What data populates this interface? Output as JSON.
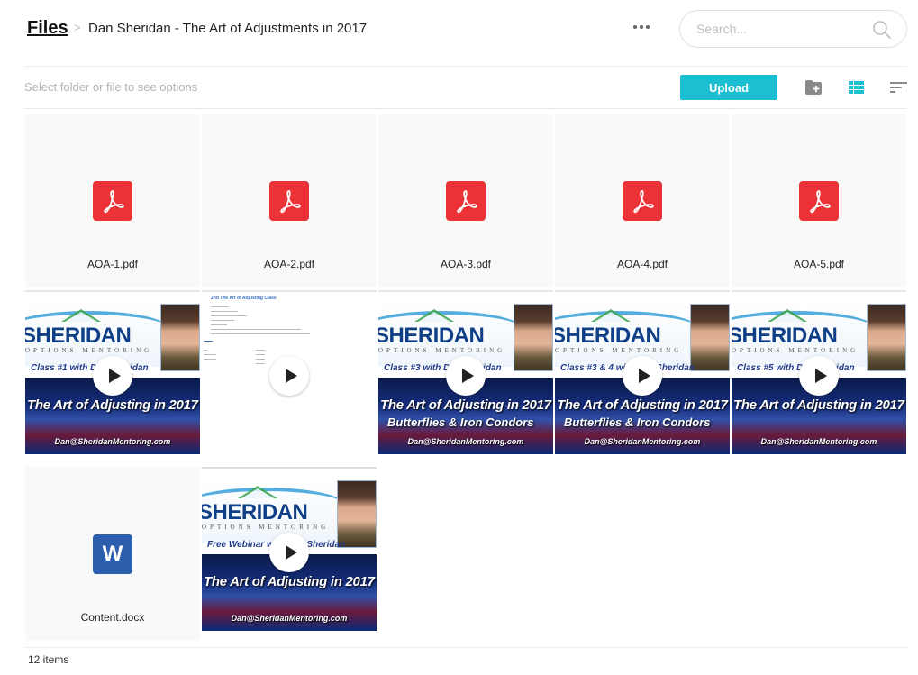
{
  "header": {
    "breadcrumb_root": "Files",
    "breadcrumb_sep": ">",
    "breadcrumb_current": "Dan Sheridan - The Art of Adjustments in 2017",
    "search_placeholder": "Search...",
    "search_value": ""
  },
  "toolbar": {
    "hint": "Select folder or file to see options",
    "upload_label": "Upload",
    "icons": [
      "new-folder-icon",
      "grid-view-icon",
      "sort-icon"
    ],
    "accent_color": "#1bbfd1"
  },
  "files": [
    {
      "name": "AOA-1.pdf",
      "type": "pdf"
    },
    {
      "name": "AOA-2.pdf",
      "type": "pdf"
    },
    {
      "name": "AOA-3.pdf",
      "type": "pdf"
    },
    {
      "name": "AOA-4.pdf",
      "type": "pdf"
    },
    {
      "name": "AOA-5.pdf",
      "type": "pdf"
    },
    {
      "name": "",
      "type": "video",
      "thumb": {
        "brand": "SHERIDAN",
        "sub": "OPTIONS MENTORING",
        "classline": "Class #1 with Dan Sheridan",
        "title": "The Art of Adjusting in 2017",
        "title2": "",
        "email": "Dan@SheridanMentoring.com"
      }
    },
    {
      "name": "",
      "type": "video-doc",
      "thumb": {
        "doc_title": "2nd The Art of Adjusting Class"
      }
    },
    {
      "name": "",
      "type": "video",
      "thumb": {
        "brand": "SHERIDAN",
        "sub": "OPTIONS MENTORING",
        "classline": "Class #3 with Dan Sheridan",
        "title": "The Art of Adjusting in 2017",
        "title2": "Butterflies & Iron Condors",
        "email": "Dan@SheridanMentoring.com"
      }
    },
    {
      "name": "",
      "type": "video",
      "thumb": {
        "brand": "SHERIDAN",
        "sub": "OPTIONS MENTORING",
        "classline": "Class #3 & 4 with Dan Sheridan",
        "title": "The Art of Adjusting in 2017",
        "title2": "Butterflies & Iron Condors",
        "email": "Dan@SheridanMentoring.com"
      }
    },
    {
      "name": "",
      "type": "video",
      "thumb": {
        "brand": "SHERIDAN",
        "sub": "OPTIONS MENTORING",
        "classline": "Class #5 with Dan Sheridan",
        "title": "The Art of Adjusting in 2017",
        "title2": "",
        "email": "Dan@SheridanMentoring.com"
      }
    },
    {
      "name": "Content.docx",
      "type": "docx",
      "icon_letter": "W"
    },
    {
      "name": "",
      "type": "video",
      "thumb": {
        "brand": "SHERIDAN",
        "sub": "OPTIONS MENTORING",
        "classline": "Free Webinar with Dan Sheridan",
        "title": "The Art of Adjusting in 2017",
        "title2": "",
        "email": "Dan@SheridanMentoring.com"
      }
    }
  ],
  "footer": {
    "item_count": "12 items"
  }
}
